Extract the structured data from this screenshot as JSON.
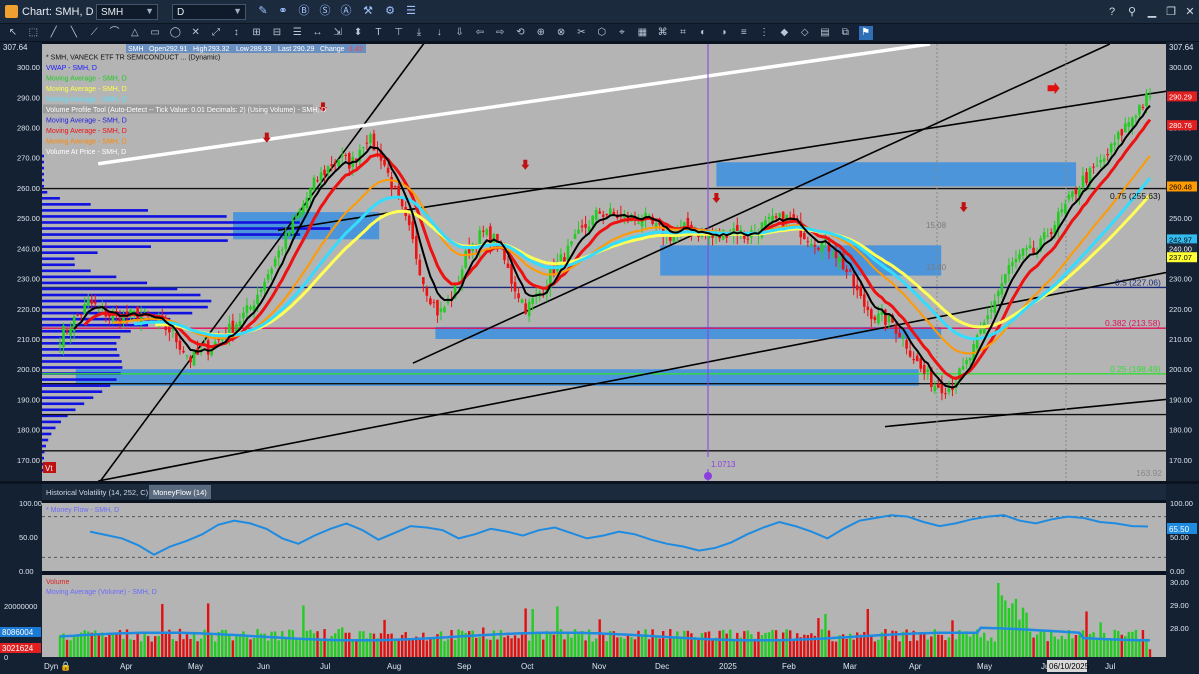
{
  "window": {
    "title": "Chart: SMH, D",
    "symbol_value": "SMH",
    "interval_value": "D",
    "help_label": "?",
    "controls": [
      "?",
      "⚲",
      "▁",
      "❐",
      "✕"
    ]
  },
  "header_strip": {
    "symbol": "SMH",
    "open_label": "Open",
    "open": "292.91",
    "high_label": "High",
    "high": "293.32",
    "low_label": "Low",
    "low": "289.33",
    "last_label": "Last",
    "last": "290.29",
    "change_label": "Change",
    "change": "-1.42"
  },
  "price_panel": {
    "top_value": "307.64",
    "legend": [
      {
        "text": "* SMH, VANECK ETF TR SEMICONDUCT ... (Dynamic)",
        "color": "#111111"
      },
      {
        "text": "VWAP - SMH, D",
        "color": "#1a1aff"
      },
      {
        "text": "Moving Average - SMH, D",
        "color": "#22cc22"
      },
      {
        "text": "Moving Average - SMH, D",
        "color": "#ffff44"
      },
      {
        "text": "Moving Average - SMH, D",
        "color": "#55e0ff"
      },
      {
        "text": "Volume Profile Tool (Auto-Detect -- Tick Value: 0.01 Decimals: 2) (Using Volume) - SMH, D",
        "color": "#ffffff"
      },
      {
        "text": "Moving Average - SMH, D",
        "color": "#2222dd"
      },
      {
        "text": "Moving Average - SMH, D",
        "color": "#ee1111"
      },
      {
        "text": "Moving Average - SMH, D",
        "color": "#ff8800"
      },
      {
        "text": "Volume At Price - SMH, D",
        "color": "#ffffff"
      }
    ],
    "fib_labels": [
      {
        "text": "0.75 (255.63)",
        "value": 255.63,
        "color": "#111111"
      },
      {
        "text": "0.5 (227.06)",
        "value": 227.06,
        "color": "#1a2a7a"
      },
      {
        "text": "0.382 (213.58)",
        "value": 213.58,
        "color": "#e0105a"
      },
      {
        "text": "0.25 (198.49)",
        "value": 198.49,
        "color": "#33dd33"
      },
      {
        "text": "163.92",
        "value": 163.92,
        "color": "#888888"
      }
    ],
    "annotation_vline": "1.0713",
    "faint_labels": [
      "15.08",
      "13.40"
    ],
    "price_tags": [
      {
        "text": "290.29",
        "value": 290.29,
        "bg": "#e02020",
        "fg": "#ffffff"
      },
      {
        "text": "280.76",
        "value": 280.76,
        "bg": "#e02020",
        "fg": "#ffffff"
      },
      {
        "text": "260.48",
        "value": 260.48,
        "bg": "#ff9a00",
        "fg": "#000000"
      },
      {
        "text": "242.97",
        "value": 242.97,
        "bg": "#33bbee",
        "fg": "#000000"
      },
      {
        "text": "240.00",
        "value": 240.0,
        "bg": "#1c2a3d",
        "fg": "#ffffff"
      },
      {
        "text": "237.07",
        "value": 237.07,
        "bg": "#ffff33",
        "fg": "#000000"
      }
    ],
    "vt_badge": "Vt"
  },
  "tabs": [
    "Historical Volatility (14, 252, C)",
    "MoneyFlow (14)"
  ],
  "mfi_panel": {
    "legend": "* Money Flow - SMH, D",
    "tag": "65.50"
  },
  "volume_panel": {
    "legend1": "Volume",
    "legend2": "Moving Average (Volume) - SMH, D",
    "left_tags": [
      "8086004",
      "3021624"
    ],
    "left_tag_colors": [
      "#1a7ad4",
      "#e02020"
    ]
  },
  "footer": {
    "dyn_label": "Dyn",
    "date_cursor": "06/10/2025"
  },
  "chart_data": {
    "type": "candlestick",
    "title": "SMH, D",
    "price_axis": {
      "ylim": [
        163,
        307.64
      ],
      "ticks": [
        170,
        180,
        190,
        200,
        210,
        220,
        230,
        240,
        250,
        260,
        270,
        280,
        290,
        300
      ]
    },
    "x_axis": {
      "tick_labels": [
        "Apr",
        "May",
        "Jun",
        "Jul",
        "Aug",
        "Sep",
        "Oct",
        "Nov",
        "Dec",
        "2025",
        "Feb",
        "Mar",
        "Apr",
        "May",
        "Jun",
        "Jul"
      ]
    },
    "price_path": [
      [
        0,
        211
      ],
      [
        8,
        222
      ],
      [
        15,
        217
      ],
      [
        22,
        218
      ],
      [
        30,
        213
      ],
      [
        36,
        203
      ],
      [
        44,
        210
      ],
      [
        52,
        220
      ],
      [
        58,
        234
      ],
      [
        64,
        248
      ],
      [
        70,
        262
      ],
      [
        76,
        270
      ],
      [
        80,
        268
      ],
      [
        84,
        277
      ],
      [
        88,
        271
      ],
      [
        92,
        258
      ],
      [
        96,
        245
      ],
      [
        100,
        228
      ],
      [
        104,
        218
      ],
      [
        108,
        225
      ],
      [
        112,
        240
      ],
      [
        116,
        245
      ],
      [
        120,
        242
      ],
      [
        124,
        229
      ],
      [
        128,
        220
      ],
      [
        132,
        226
      ],
      [
        136,
        234
      ],
      [
        140,
        240
      ],
      [
        144,
        247
      ],
      [
        148,
        252
      ],
      [
        152,
        251
      ],
      [
        156,
        250
      ],
      [
        160,
        250
      ],
      [
        164,
        246
      ],
      [
        168,
        244
      ],
      [
        172,
        247
      ],
      [
        176,
        245
      ],
      [
        180,
        243
      ],
      [
        184,
        247
      ],
      [
        188,
        244
      ],
      [
        192,
        247
      ],
      [
        196,
        249
      ],
      [
        200,
        250
      ],
      [
        204,
        245
      ],
      [
        208,
        242
      ],
      [
        212,
        240
      ],
      [
        216,
        232
      ],
      [
        220,
        222
      ],
      [
        224,
        217
      ],
      [
        228,
        216
      ],
      [
        232,
        209
      ],
      [
        236,
        200
      ],
      [
        240,
        195
      ],
      [
        244,
        194
      ],
      [
        248,
        200
      ],
      [
        252,
        210
      ],
      [
        256,
        222
      ],
      [
        260,
        233
      ],
      [
        264,
        238
      ],
      [
        268,
        239
      ],
      [
        272,
        247
      ],
      [
        276,
        254
      ],
      [
        280,
        262
      ],
      [
        284,
        266
      ],
      [
        288,
        272
      ],
      [
        292,
        280
      ],
      [
        296,
        287
      ],
      [
        299,
        290.29
      ]
    ],
    "vwap_profile_band_prices": [
      222,
      218,
      214,
      210,
      206,
      202,
      198,
      194,
      190,
      186,
      182,
      178,
      226,
      230,
      234,
      238,
      242,
      246,
      250,
      254,
      258,
      262,
      266
    ],
    "moving_averages": [
      {
        "color": "#ee1111",
        "width": 3,
        "lag": 6
      },
      {
        "color": "#ff9a00",
        "width": 2,
        "lag": 14
      },
      {
        "color": "#ffff55",
        "width": 3,
        "lag": 26
      },
      {
        "color": "#33ddff",
        "width": 3,
        "lag": 20
      },
      {
        "color": "#000000",
        "width": 2,
        "lag": 3
      }
    ],
    "horizontal_levels": [
      {
        "value": 259.8,
        "color": "#111111"
      },
      {
        "value": 227.06,
        "color": "#1a2a7a"
      },
      {
        "value": 213.58,
        "color": "#e0105a"
      },
      {
        "value": 198.49,
        "color": "#33dd33"
      },
      {
        "value": 195.2,
        "color": "#111111"
      },
      {
        "value": 185.0,
        "color": "#111111"
      },
      {
        "value": 173.0,
        "color": "#111111"
      }
    ],
    "blue_zones": [
      {
        "from": 0.6,
        "to": 0.92,
        "low": 260.5,
        "high": 268.5
      },
      {
        "from": 0.55,
        "to": 0.8,
        "low": 231,
        "high": 241
      },
      {
        "from": 0.17,
        "to": 0.3,
        "low": 243,
        "high": 252
      },
      {
        "from": 0.35,
        "to": 0.8,
        "low": 210,
        "high": 214
      },
      {
        "from": 0.03,
        "to": 0.78,
        "low": 194.5,
        "high": 200
      }
    ],
    "trend_lines": [
      {
        "x1": 0.05,
        "y1": 162,
        "x2": 0.36,
        "y2": 318,
        "color": "#000000"
      },
      {
        "x1": 0.05,
        "y1": 268,
        "x2": 0.79,
        "y2": 307.64,
        "color": "#ffffff"
      },
      {
        "x1": 0.21,
        "y1": 246,
        "x2": 1.0,
        "y2": 292,
        "color": "#000000"
      },
      {
        "x1": 0.33,
        "y1": 202,
        "x2": 0.95,
        "y2": 307.64,
        "color": "#000000"
      },
      {
        "x1": 0.05,
        "y1": 163,
        "x2": 1.0,
        "y2": 232,
        "color": "#000000"
      },
      {
        "x1": 0.75,
        "y1": 181,
        "x2": 1.0,
        "y2": 190,
        "color": "#000000"
      }
    ],
    "red_arrows": [
      [
        0.2,
        276
      ],
      [
        0.25,
        286
      ],
      [
        0.43,
        267
      ],
      [
        0.6,
        256
      ],
      [
        0.82,
        253
      ],
      [
        0.9,
        293
      ]
    ],
    "mfi": {
      "ylim": [
        0,
        100
      ],
      "ticks": [
        0.0,
        50.0,
        100.0
      ],
      "levels": [
        20,
        80
      ],
      "values": [
        58,
        53,
        48,
        38,
        24,
        36,
        44,
        54,
        68,
        74,
        70,
        62,
        48,
        40,
        52,
        62,
        70,
        60,
        46,
        56,
        66,
        64,
        60,
        48,
        54,
        62,
        58,
        52,
        60,
        64,
        56,
        48,
        52,
        58,
        54,
        46,
        40,
        36,
        30,
        34,
        42,
        54,
        64,
        72,
        66,
        58,
        48,
        62,
        74,
        78,
        82,
        80,
        72,
        66,
        70,
        76,
        80,
        82,
        74,
        70,
        76,
        80,
        78,
        72,
        70,
        66,
        65.5
      ]
    },
    "volume": {
      "ticks": [
        0,
        10000000,
        20000000
      ],
      "right_ticks": [
        "28.00",
        "29.00",
        "30.00"
      ],
      "ma_value": 8086004,
      "last_volume": 3021624
    }
  }
}
